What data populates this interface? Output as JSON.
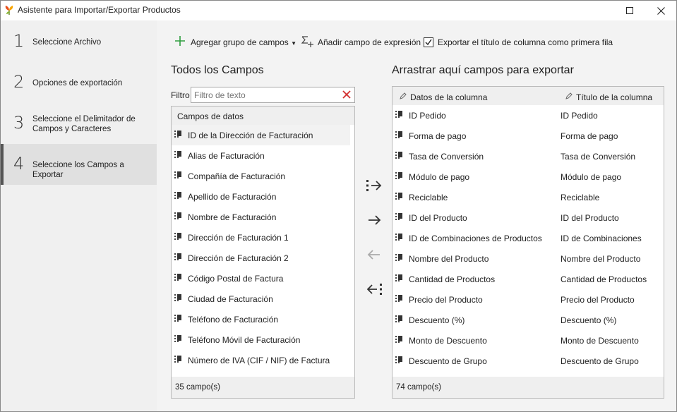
{
  "window": {
    "title": "Asistente para Importar/Exportar Productos",
    "maximize_icon": "maximize-icon",
    "close_icon": "close-icon"
  },
  "sidebar": {
    "steps": [
      {
        "num": "1",
        "label": "Seleccione Archivo"
      },
      {
        "num": "2",
        "label": "Opciones de exportación"
      },
      {
        "num": "3",
        "label": "Seleccione el Delimitador de Campos y Caracteres"
      },
      {
        "num": "4",
        "label": "Seleccione los Campos a Exportar"
      }
    ],
    "active_step": 4
  },
  "toolbar": {
    "add_group_label": "Agregar grupo de campos",
    "add_expression_label": "Añadir campo de expresión",
    "export_title_label": "Exportar el título de columna como primera fila",
    "export_title_checked": true
  },
  "left": {
    "title": "Todos los Campos",
    "filter_label": "Filtro",
    "filter_placeholder": "Filtro de texto",
    "header": "Campos de datos",
    "items": [
      "ID de la Dirección de Facturación",
      "Alias de Facturación",
      "Compañía de Facturación",
      "Apellido de Facturación",
      "Nombre de Facturación",
      "Dirección de Facturación 1",
      "Dirección de Facturación 2",
      "Código Postal de Factura",
      "Ciudad de Facturación",
      "Teléfono de Facturación",
      "Teléfono Móvil de Facturación",
      "Número de IVA (CIF / NIF) de Factura"
    ],
    "footer": "35 campo(s)"
  },
  "right": {
    "title": "Arrastrar aquí campos para exportar",
    "col1_header": "Datos de la columna",
    "col2_header": "Título de la columna",
    "rows": [
      {
        "data": "ID Pedido",
        "title": "ID Pedido"
      },
      {
        "data": "Forma de pago",
        "title": "Forma de pago"
      },
      {
        "data": "Tasa de Conversión",
        "title": "Tasa de Conversión"
      },
      {
        "data": "Módulo de pago",
        "title": "Módulo de pago"
      },
      {
        "data": "Reciclable",
        "title": "Reciclable"
      },
      {
        "data": "ID del Producto",
        "title": "ID del Producto"
      },
      {
        "data": "ID de Combinaciones de Productos",
        "title": "ID de Combinaciones"
      },
      {
        "data": "Nombre del Producto",
        "title": "Nombre del Producto"
      },
      {
        "data": "Cantidad de Productos",
        "title": "Cantidad de Productos"
      },
      {
        "data": "Precio del Producto",
        "title": "Precio del Producto"
      },
      {
        "data": "Descuento (%)",
        "title": "Descuento (%)"
      },
      {
        "data": "Monto de Descuento",
        "title": "Monto de Descuento"
      },
      {
        "data": "Descuento de Grupo",
        "title": "Descuento de Grupo"
      }
    ],
    "footer": "74 campo(s)"
  },
  "colors": {
    "sidebar_bg": "#f0f0f0",
    "active_step_bg": "#e0e0e0",
    "plus_green": "#2e9e3e",
    "clear_red": "#d32f2f"
  }
}
